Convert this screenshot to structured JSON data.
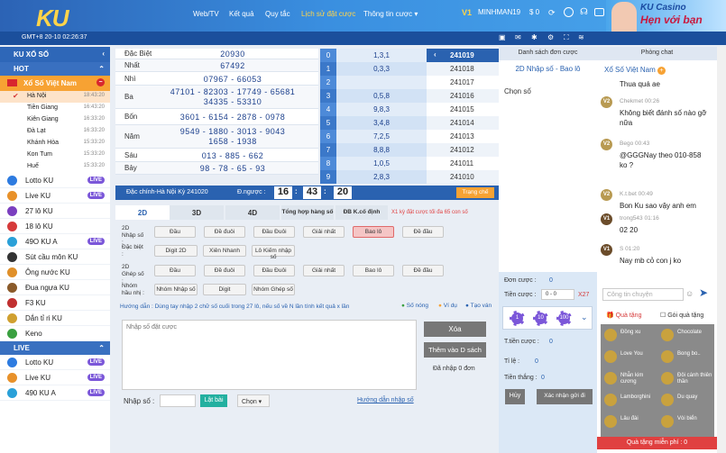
{
  "header": {
    "logo": "KU",
    "nav": [
      "Web/TV",
      "Kết quả",
      "Quy tắc",
      "Lịch sử đặt cược",
      "Thông tin cược ▾"
    ],
    "vip": "V1",
    "username": "MINHMAN19",
    "balance": "$ 0",
    "banner_line1": "KU Casino",
    "banner_line2": "Hẹn với bạn"
  },
  "subbar": {
    "time": "GMT+8 20-10 02:26:37"
  },
  "sidebar": {
    "title": "KU XỔ SỐ",
    "hot": "HOT",
    "group": "Xổ Số Việt Nam",
    "regions": [
      {
        "name": "Hà Nội",
        "time": "18:43:20"
      },
      {
        "name": "Tiền Giang",
        "time": "16:43:20"
      },
      {
        "name": "Kiên Giang",
        "time": "16:33:20"
      },
      {
        "name": "Đà Lạt",
        "time": "16:33:20"
      },
      {
        "name": "Khánh Hòa",
        "time": "15:33:20"
      },
      {
        "name": "Kon Tum",
        "time": "15:33:20"
      },
      {
        "name": "Huế",
        "time": "15:33:20"
      }
    ],
    "games": [
      {
        "name": "Lotto KU",
        "live": "LIVE",
        "color": "#2d7be0"
      },
      {
        "name": "Live KU",
        "live": "LIVE",
        "color": "#e8912a"
      },
      {
        "name": "27 lô KU",
        "live": "",
        "color": "#7b3fbf"
      },
      {
        "name": "18 lô KU",
        "live": "",
        "color": "#d63a3a"
      },
      {
        "name": "49O KU A",
        "live": "LIVE",
        "color": "#2aa0d8"
      },
      {
        "name": "Sút cầu môn KU",
        "live": "",
        "color": "#333"
      },
      {
        "name": "Ông nước KU",
        "live": "",
        "color": "#e0902a"
      },
      {
        "name": "Đua ngựa KU",
        "live": "",
        "color": "#8a5a2a"
      },
      {
        "name": "F3 KU",
        "live": "",
        "color": "#c03030"
      },
      {
        "name": "Dắn tỉ ri KU",
        "live": "",
        "color": "#d0a030"
      },
      {
        "name": "Keno",
        "live": "",
        "color": "#3aa040"
      }
    ],
    "live_section": "LIVE",
    "live_games": [
      {
        "name": "Lotto KU",
        "live": "LIVE",
        "color": "#2d7be0"
      },
      {
        "name": "Live KU",
        "live": "LIVE",
        "color": "#e8912a"
      },
      {
        "name": "490 KU A",
        "live": "LIVE",
        "color": "#2aa0d8"
      }
    ]
  },
  "results": [
    {
      "label": "Đặc Biệt",
      "value": "20930",
      "h": 12
    },
    {
      "label": "Nhất",
      "value": "67492",
      "h": 14
    },
    {
      "label": "Nhì",
      "value": "07967 - 66053",
      "h": 15
    },
    {
      "label": "Ba",
      "value": "47101 - 82303 - 17749 - 65681\n34335 - 53310",
      "h": 26
    },
    {
      "label": "Bốn",
      "value": "3601 - 6154 - 2878 - 0978",
      "h": 18
    },
    {
      "label": "Năm",
      "value": "9549 - 1880 - 3013 - 9043\n1658 - 1938",
      "h": 26
    },
    {
      "label": "Sáu",
      "value": "013 - 885 - 662",
      "h": 15
    },
    {
      "label": "Bảy",
      "value": "98 - 78 - 65 - 93",
      "h": 14
    }
  ],
  "stats": [
    {
      "n": "0",
      "v": "1,3,1",
      "c": "241019"
    },
    {
      "n": "1",
      "v": "0,3,3",
      "c": "241018"
    },
    {
      "n": "2",
      "v": "",
      "c": "241017"
    },
    {
      "n": "3",
      "v": "0,5,8",
      "c": "241016"
    },
    {
      "n": "4",
      "v": "9,8,3",
      "c": "241015"
    },
    {
      "n": "5",
      "v": "3,4,8",
      "c": "241014"
    },
    {
      "n": "6",
      "v": "7,2,5",
      "c": "241013"
    },
    {
      "n": "7",
      "v": "8,8,8",
      "c": "241012"
    },
    {
      "n": "8",
      "v": "1,0,5",
      "c": "241011"
    },
    {
      "n": "9",
      "v": "2,8,3",
      "c": "241010"
    }
  ],
  "control": {
    "period": "Đặc chính-Hà Nội Kỳ 241020",
    "countdown_label": "Đ.ngược :",
    "h": "16",
    "m": "43",
    "s": "20",
    "trend": "Trạng chế"
  },
  "tabs": [
    "2D",
    "3D",
    "4D",
    "Tổng hợp hàng số",
    "ĐB K.cố định"
  ],
  "notice": "X1 kỳ đặt cược tối đa 65 con số",
  "bet_groups": [
    {
      "label": "2D Nhập số :",
      "buttons": [
        "Đầu",
        "Đề đuôi",
        "Đầu Đuôi",
        "Giải nhất",
        "Bao lô",
        "Đề đầu"
      ]
    },
    {
      "label": "Đặc biệt :",
      "buttons": [
        "Digit 2D",
        "Xiên Nhanh",
        "Lô Kiếm nhập số"
      ]
    },
    {
      "label": "2D Ghép số :",
      "buttons": [
        "Đầu",
        "Đề đuôi",
        "Đầu Đuôi",
        "Giải nhất",
        "Bao lô",
        "Đề đầu"
      ]
    },
    {
      "label": "Nhóm hầu nhị :",
      "buttons": [
        "Nhóm Nhập số",
        "Digit",
        "Nhóm Ghép số"
      ]
    }
  ],
  "guide": "Hướng dẫn : Dùng tay nhập 2 chữ số cuối trong 27 lô, nếu số về N lần tính kết quả x lần",
  "guide_links": [
    "Số nóng",
    "Ví dụ",
    "Tạo ván"
  ],
  "input": {
    "placeholder": "Nhập số đặt cược",
    "delete": "Xóa",
    "add": "Thêm vào D sách",
    "bet_count": "Đã nhập 0 đơn",
    "number_label": "Nhập số :",
    "ok": "Lật bài",
    "choose": "Chọn ▾",
    "guide_link": "Hướng dẫn nhập số"
  },
  "right_panel": {
    "title": "Danh sách đơn cược",
    "sub": "2D Nhập số - Bao lô",
    "choose": "Chọn số",
    "order_label": "Đơn cược :",
    "order_value": "0",
    "amount_label": "Tiền cược :",
    "amount_value": "0 - 0",
    "mult": "X27",
    "chips": [
      "1",
      "10",
      "100"
    ],
    "total_label": "T.tiền cược :",
    "total_value": "0",
    "rate_label": "Tỉ lệ :",
    "rate_value": "0",
    "win_label": "Tiền thắng :",
    "win_value": "0",
    "cancel": "Hủy",
    "confirm": "Xác nhận gửi đi"
  },
  "chat": {
    "title": "Phòng chat",
    "group": "Xổ Số Việt Nam",
    "messages": [
      {
        "badge": "",
        "name": "",
        "text": "Thua quá ae"
      },
      {
        "badge": "V2",
        "name": "Chekmet 00:26",
        "text": "Không biết đánh số nào gỡ nữa"
      },
      {
        "badge": "V2",
        "name": "Bego 00:43",
        "text": "@GGGNay theo 010-858 ko ?"
      },
      {
        "badge": "V2",
        "name": "K.t.bet 00:49",
        "text": "Bon Ku sao vậy anh em"
      },
      {
        "badge": "V1",
        "name": "trong543 01:16",
        "text": "02 20"
      },
      {
        "badge": "V1",
        "name": "S 01:20",
        "text": "Nay mb cỏ con j ko"
      }
    ],
    "input_placeholder": "Công tin chuyện",
    "tab_gift": "Quà tặng",
    "tab_receive": "Gói quà tặng",
    "gifts": [
      "Đồng xu",
      "Chocolate",
      "Love You",
      "Bong bo..",
      "Nhẫn kim cương",
      "Đôi cánh thiên thần",
      "Lamborghini",
      "Du quay",
      "Lâu đài",
      "Vòi biển"
    ],
    "footer": "Quà tặng miễn phí : 0"
  }
}
